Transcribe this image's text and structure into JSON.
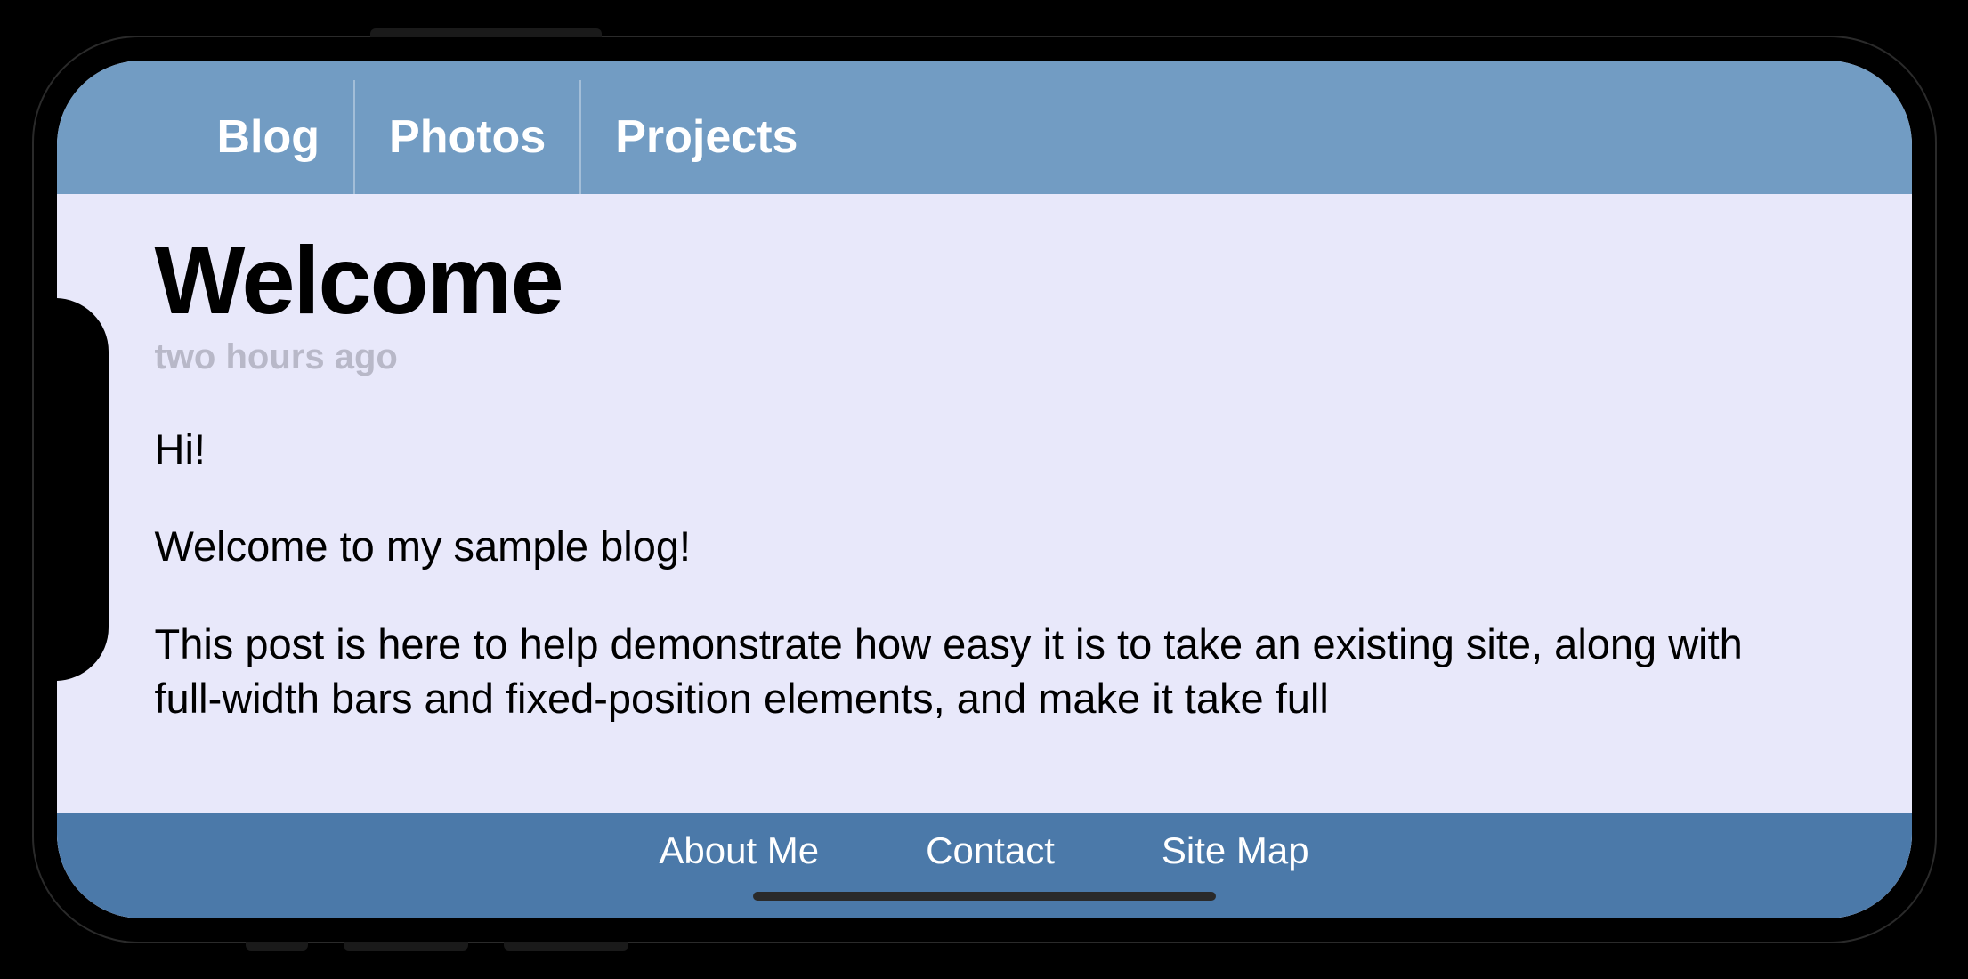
{
  "topNav": {
    "tabs": [
      {
        "label": "Blog"
      },
      {
        "label": "Photos"
      },
      {
        "label": "Projects"
      }
    ]
  },
  "post": {
    "title": "Welcome",
    "timestamp": "two hours ago",
    "paragraphs": [
      "Hi!",
      "Welcome to my sample blog!",
      "This post is here to help demonstrate how easy it is to take an existing site, along with full-width bars and fixed-position elements, and make it take full"
    ]
  },
  "footer": {
    "links": [
      {
        "label": "About Me"
      },
      {
        "label": "Contact"
      },
      {
        "label": "Site Map"
      }
    ]
  }
}
